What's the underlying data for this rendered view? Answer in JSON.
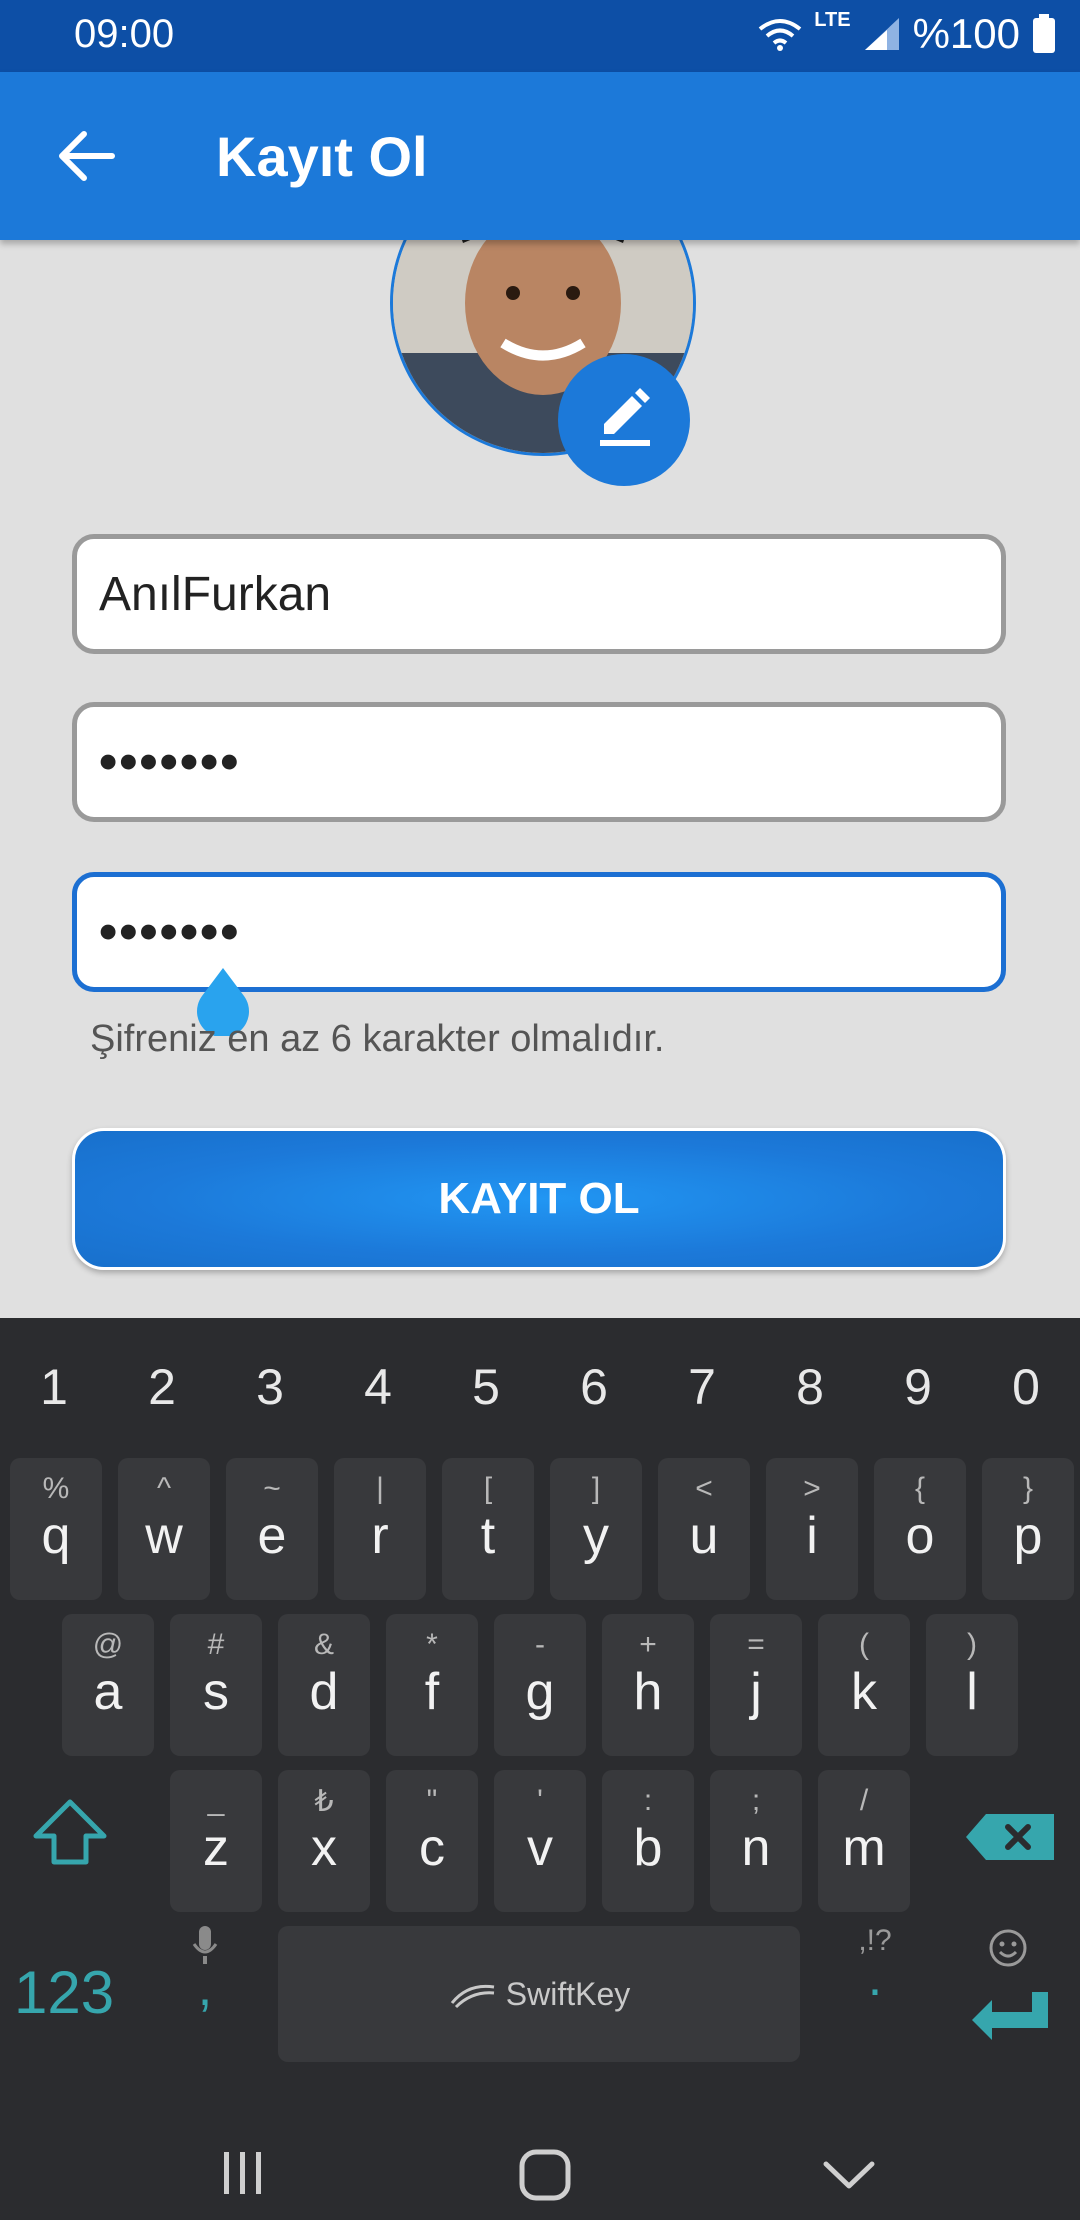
{
  "status": {
    "time": "09:00",
    "network": "LTE",
    "battery": "%100"
  },
  "appbar": {
    "title": "Kayıt Ol"
  },
  "form": {
    "username": "AnılFurkan",
    "password": "•••••••",
    "password_confirm": "•••••••",
    "hint": "Şifreniz en az 6 karakter olmalıdır.",
    "submit_label": "KAYIT OL"
  },
  "keyboard": {
    "numbers": [
      "1",
      "2",
      "3",
      "4",
      "5",
      "6",
      "7",
      "8",
      "9",
      "0"
    ],
    "row1": [
      {
        "k": "q",
        "s": "%"
      },
      {
        "k": "w",
        "s": "^"
      },
      {
        "k": "e",
        "s": "~"
      },
      {
        "k": "r",
        "s": "|"
      },
      {
        "k": "t",
        "s": "["
      },
      {
        "k": "y",
        "s": "]"
      },
      {
        "k": "u",
        "s": "<"
      },
      {
        "k": "i",
        "s": ">"
      },
      {
        "k": "o",
        "s": "{"
      },
      {
        "k": "p",
        "s": "}"
      }
    ],
    "row2": [
      {
        "k": "a",
        "s": "@"
      },
      {
        "k": "s",
        "s": "#"
      },
      {
        "k": "d",
        "s": "&"
      },
      {
        "k": "f",
        "s": "*"
      },
      {
        "k": "g",
        "s": "-"
      },
      {
        "k": "h",
        "s": "+"
      },
      {
        "k": "j",
        "s": "="
      },
      {
        "k": "k",
        "s": "("
      },
      {
        "k": "l",
        "s": ")"
      }
    ],
    "row3": [
      {
        "k": "z",
        "s": "_"
      },
      {
        "k": "x",
        "s": "₺"
      },
      {
        "k": "c",
        "s": "\""
      },
      {
        "k": "v",
        "s": "'"
      },
      {
        "k": "b",
        "s": ":"
      },
      {
        "k": "n",
        "s": ";"
      },
      {
        "k": "m",
        "s": "/"
      }
    ],
    "symbols_key": "123",
    "comma": ",",
    "space_brand": "SwiftKey",
    "period_alt": ",!?",
    "period": "."
  },
  "colors": {
    "primary": "#1c79d9",
    "status_bar": "#0d4fa6",
    "keyboard_bg": "#2b2c2f",
    "key_bg": "#38393c",
    "accent_teal": "#36a6ad"
  }
}
